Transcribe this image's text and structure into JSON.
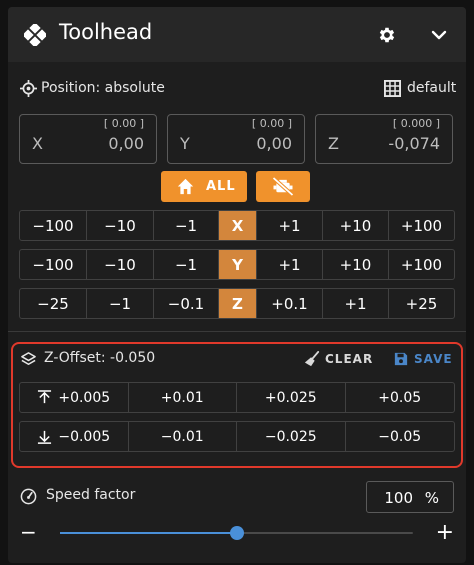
{
  "header": {
    "title": "Toolhead"
  },
  "position": {
    "mode_label": "Position: absolute",
    "profile_label": "default",
    "fields": [
      {
        "axis": "X",
        "value": "0,00",
        "bracket": "[ 0.00 ]"
      },
      {
        "axis": "Y",
        "value": "0,00",
        "bracket": "[ 0.00 ]"
      },
      {
        "axis": "Z",
        "value": "-0,074",
        "bracket": "[ 0.000 ]"
      }
    ]
  },
  "home": {
    "all_label": "ALL"
  },
  "jog": {
    "rows": [
      {
        "axis": "X",
        "neg": [
          "−100",
          "−10",
          "−1"
        ],
        "pos": [
          "+1",
          "+10",
          "+100"
        ]
      },
      {
        "axis": "Y",
        "neg": [
          "−100",
          "−10",
          "−1"
        ],
        "pos": [
          "+1",
          "+10",
          "+100"
        ]
      },
      {
        "axis": "Z",
        "neg": [
          "−25",
          "−1",
          "−0.1"
        ],
        "pos": [
          "+0.1",
          "+1",
          "+25"
        ]
      }
    ]
  },
  "zoffset": {
    "label": "Z-Offset: -0.050",
    "clear_label": "CLEAR",
    "save_label": "SAVE",
    "up": [
      "+0.005",
      "+0.01",
      "+0.025",
      "+0.05"
    ],
    "down": [
      "−0.005",
      "−0.01",
      "−0.025",
      "−0.05"
    ]
  },
  "speed": {
    "label": "Speed factor",
    "value": "100",
    "unit": "%",
    "slider_fraction": 0.5,
    "minus": "−",
    "plus": "+"
  },
  "colors": {
    "accent_orange": "#f0922c",
    "axis_orange": "#d3863c",
    "highlight_red": "#e0392b",
    "slider_blue": "#4a90d9",
    "save_blue": "#4a86c8"
  }
}
